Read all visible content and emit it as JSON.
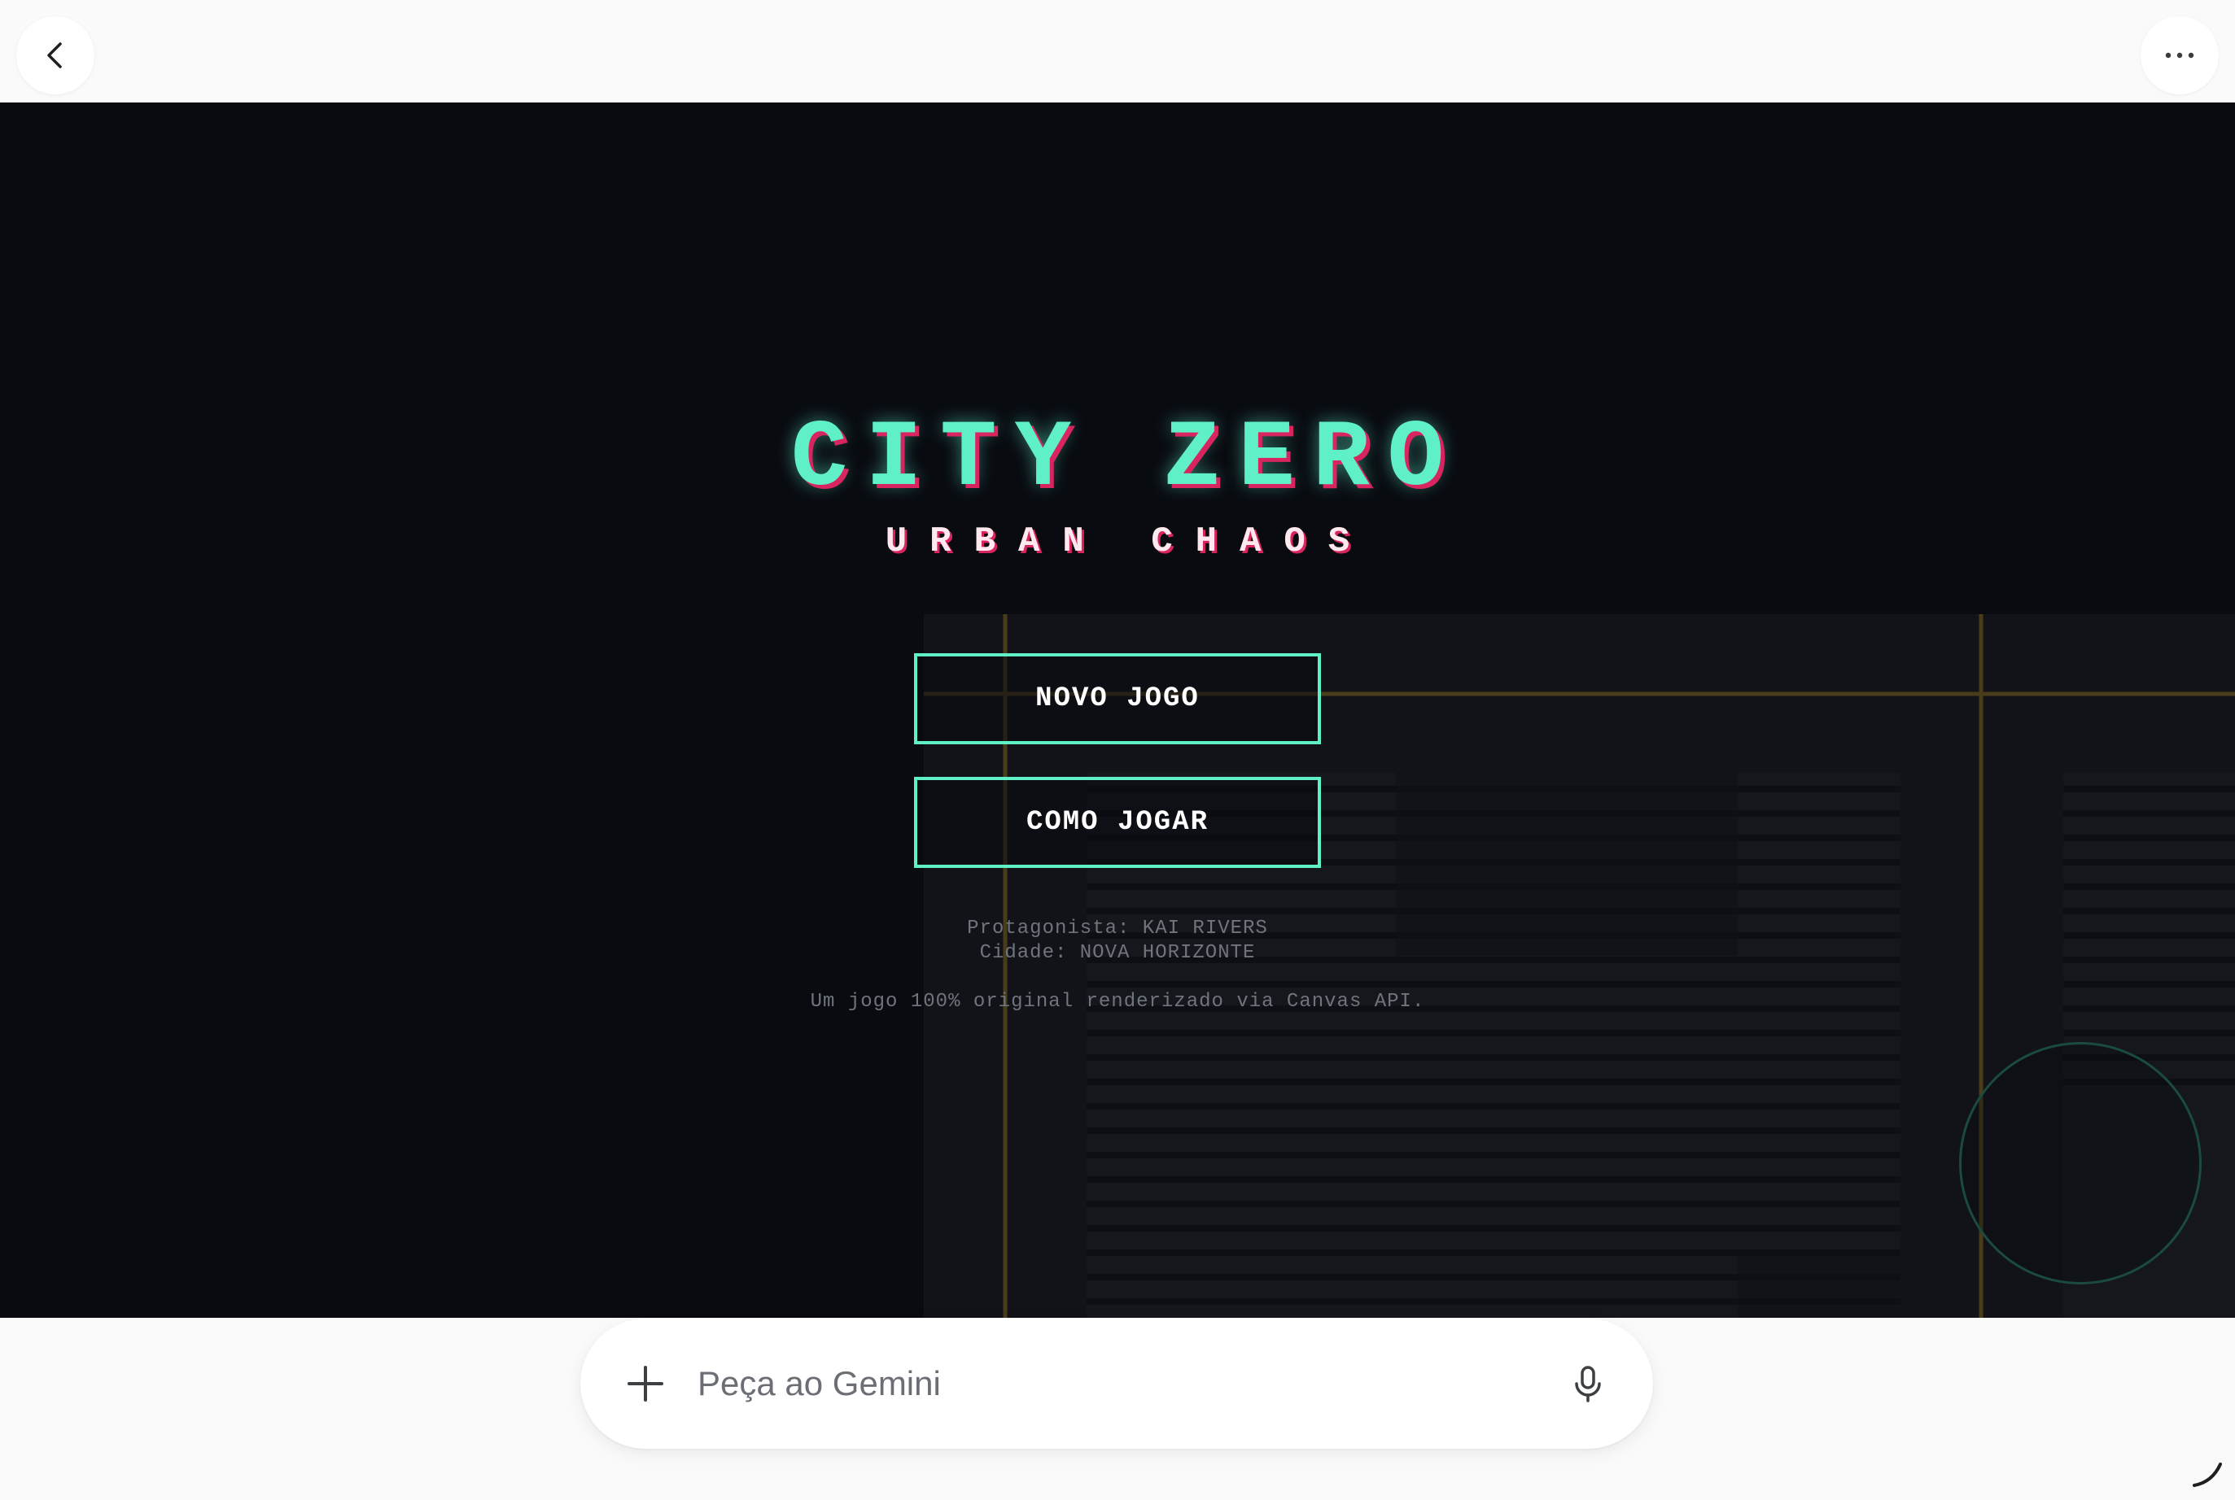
{
  "top_bar": {
    "back_icon": "chevron-left-icon",
    "more_icon": "more-horizontal-icon"
  },
  "game": {
    "title": "CITY ZERO",
    "subtitle": "URBAN CHAOS",
    "menu": {
      "new_game": "NOVO JOGO",
      "how_to_play": "COMO JOGAR"
    },
    "info": {
      "protagonist": "Protagonista: KAI RIVERS",
      "city": "Cidade: NOVA HORIZONTE",
      "credit": "Um jogo 100% original renderizado via Canvas API."
    },
    "colors": {
      "background": "#090b11",
      "accent": "#5ff0c8",
      "title_shadow": "#d8255f",
      "road_line": "#5c4a1a"
    }
  },
  "prompt": {
    "placeholder": "Peça ao Gemini",
    "value": "",
    "add_icon": "plus-icon",
    "mic_icon": "microphone-icon"
  },
  "corner_icon": "resize-handle-icon"
}
